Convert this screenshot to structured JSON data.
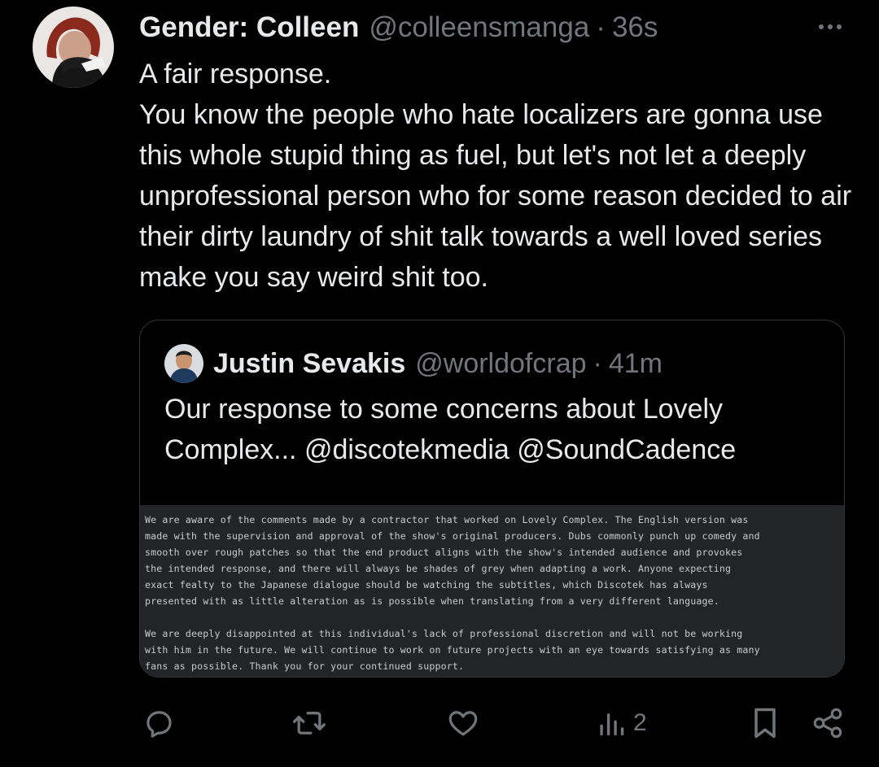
{
  "post": {
    "author": {
      "display_name": "Gender: Colleen",
      "handle": "@colleensmanga",
      "separator": "·",
      "time": "36s"
    },
    "more_label": "More options",
    "body": [
      "A fair response.",
      "You know the people who hate localizers are gonna use this whole stupid thing as fuel, but let's not let a deeply unprofessional person who for some reason decided to air their dirty laundry of shit talk towards a well loved series make you say weird shit too."
    ]
  },
  "quoted_post": {
    "author": {
      "display_name": "Justin Sevakis",
      "handle": "@worldofcrap",
      "separator": "·",
      "time": "41m"
    },
    "text": "Our response to some concerns about Lovely Complex... @discotekmedia @SoundCadence",
    "statement_lines": [
      "We are aware of the comments made by a contractor that worked on Lovely Complex. The English version was",
      "made with the supervision and approval of the show's original producers. Dubs commonly punch up comedy and",
      "smooth over rough patches so that the end product aligns with the show's intended audience and provokes",
      "the intended response, and there will always be shades of grey when adapting a work. Anyone expecting",
      "exact fealty to the Japanese dialogue should be watching the subtitles, which Discotek has always",
      "presented with as little alteration as is possible when translating from a very different language.",
      "",
      "We are deeply disappointed at this individual's lack of professional discretion and will not be working",
      "with him in the future. We will continue to work on future projects with an eye towards satisfying as many",
      "fans as possible. Thank you for your continued support."
    ]
  },
  "actions": {
    "reply": {
      "icon": "reply-icon"
    },
    "repost": {
      "icon": "repost-icon"
    },
    "like": {
      "icon": "heart-icon"
    },
    "views": {
      "icon": "views-icon",
      "count": "2"
    },
    "bookmark": {
      "icon": "bookmark-icon"
    },
    "share": {
      "icon": "share-icon"
    }
  },
  "colors": {
    "background": "#000000",
    "text": "#e7e9ea",
    "secondary": "#71767b",
    "border": "#2f3336",
    "statement_bg": "#232428"
  }
}
